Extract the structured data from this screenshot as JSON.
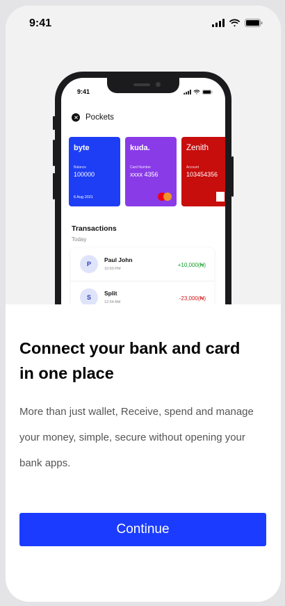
{
  "status_bar": {
    "time": "9:41"
  },
  "phone_mockup": {
    "status_time": "9:41",
    "pockets_title": "Pockets",
    "cards": [
      {
        "brand": "byte",
        "label": "Balance",
        "value": "100000",
        "date": "6 Aug 2021",
        "color": "#1e3ef5"
      },
      {
        "brand": "kuda.",
        "label": "Card Number",
        "value": "xxxx 4356",
        "color": "#8a3be8"
      },
      {
        "brand": "Zenith",
        "label": "Account",
        "value": "103454356",
        "color": "#c80d0d"
      }
    ],
    "transactions_title": "Transactions",
    "transactions_day": "Today",
    "transactions": [
      {
        "initial": "P",
        "name": "Paul John",
        "time": "10:50 PM",
        "amount": "+10,000(₦)"
      },
      {
        "initial": "S",
        "name": "Split",
        "time": "12:04 AM",
        "amount": "-23,000(₦)"
      }
    ]
  },
  "headline": "Connect your bank and card in one place",
  "description": "More than just wallet, Receive, spend and manage your money, simple, secure without opening your bank apps.",
  "continue_label": "Continue",
  "colors": {
    "accent": "#1b3cff",
    "positive": "#12a02a",
    "negative": "#d21414"
  }
}
